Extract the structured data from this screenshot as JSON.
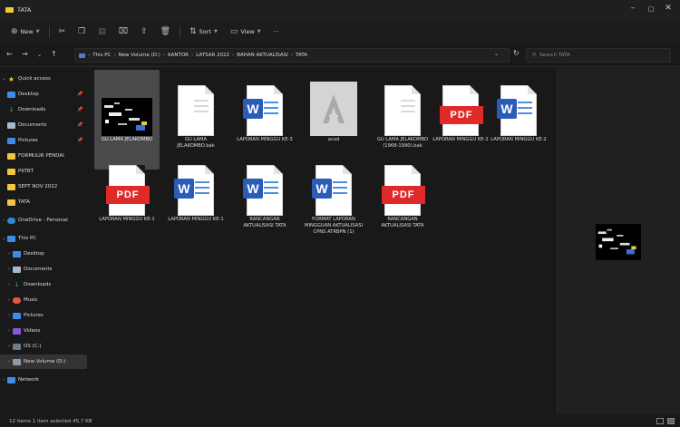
{
  "window": {
    "title": "TATA",
    "controls": [
      "–",
      "▢",
      "✕"
    ]
  },
  "toolbar": {
    "new_label": "New",
    "sort_label": "Sort",
    "view_label": "View",
    "more_label": "···"
  },
  "address": {
    "segments": [
      "This PC",
      "New Volume (D:)",
      "KANTOR",
      "LATSAR 2022",
      "BAHAN AKTUALISASI",
      "TATA"
    ],
    "search_placeholder": "Search TATA"
  },
  "nav": {
    "quick_access": "Quick access",
    "items": [
      {
        "label": "Desktop",
        "pinned": true
      },
      {
        "label": "Downloads",
        "pinned": true
      },
      {
        "label": "Documents",
        "pinned": true
      },
      {
        "label": "Pictures",
        "pinned": true
      },
      {
        "label": "FORMULIR PENDAI",
        "pinned": false
      },
      {
        "label": "PKTBT",
        "pinned": false
      },
      {
        "label": "SEPT NOV 2022",
        "pinned": false
      },
      {
        "label": "TATA",
        "pinned": false
      }
    ],
    "onedrive": "OneDrive - Personal",
    "this_pc": "This PC",
    "pc_items": [
      "Desktop",
      "Documents",
      "Downloads",
      "Music",
      "Pictures",
      "Videos",
      "OS (C:)",
      "New Volume (D:)"
    ],
    "network": "Network"
  },
  "files": [
    {
      "name": "GU LAMA JELAKOMBO",
      "type": "image",
      "selected": true
    },
    {
      "name": "GU LAMA JELAKOMBO.bak",
      "type": "blank"
    },
    {
      "name": "LAPORAN MINGGU KE-3",
      "type": "word"
    },
    {
      "name": "acad",
      "type": "acad"
    },
    {
      "name": "GU LAMA JELAKOMBO (1968-1990).bak",
      "type": "blank"
    },
    {
      "name": "LAPORAN MINGGU KE-2",
      "type": "pdf"
    },
    {
      "name": "LAPORAN MINGGU KE-2",
      "type": "word"
    },
    {
      "name": "LAPORAN MINGGU KE-1",
      "type": "pdf"
    },
    {
      "name": "LAPORAN MINGGU KE-1",
      "type": "word"
    },
    {
      "name": "RANCANGAN AKTUALISASI TATA",
      "type": "word"
    },
    {
      "name": "FORMAT LAPORAN MINGGUAN AKTUALISASI CPNS ATRBPN (1)",
      "type": "word"
    },
    {
      "name": "RANCANGAN AKTUALISASI TATA",
      "type": "pdf"
    }
  ],
  "status": {
    "text": "12 items   1 item selected  45,7 KB"
  },
  "icons": {
    "new": "plus-circle-icon",
    "cut": "scissors-icon",
    "copy": "copy-icon",
    "paste": "clipboard-icon",
    "rename": "rename-icon",
    "share": "share-icon",
    "delete": "trash-icon"
  },
  "colors": {
    "folder": "#f3c640",
    "word": "#2b5cb7",
    "pdf": "#e02a2a",
    "selection": "#4a4a4a"
  }
}
